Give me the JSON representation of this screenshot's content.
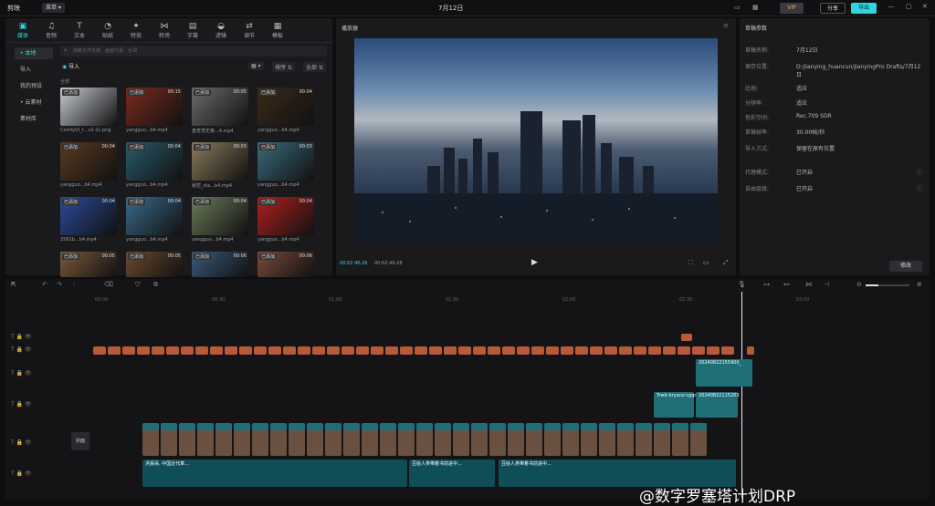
{
  "app": {
    "name": "剪映",
    "menu": "菜单 ▾",
    "title": "7月12日",
    "vip_label": "VIP",
    "share_label": "分享",
    "export_label": "导出"
  },
  "media": {
    "tools": [
      {
        "label": "媒体",
        "icon": "▣"
      },
      {
        "label": "音频",
        "icon": "♫"
      },
      {
        "label": "文本",
        "icon": "T"
      },
      {
        "label": "贴纸",
        "icon": "◔"
      },
      {
        "label": "特效",
        "icon": "✦"
      },
      {
        "label": "转场",
        "icon": "⋈"
      },
      {
        "label": "字幕",
        "icon": "▤"
      },
      {
        "label": "滤镜",
        "icon": "◒"
      },
      {
        "label": "调节",
        "icon": "⇄"
      },
      {
        "label": "模板",
        "icon": "▦"
      }
    ],
    "sidebar": [
      "• 本地",
      "导入",
      "我的预设",
      "• 云素材",
      "素材库"
    ],
    "search_placeholder": "搜索文件名称、画面元素、台词",
    "import_label": "导入",
    "sort_label": "排序 ⇅",
    "filter_label": "全部 ⇅",
    "section_label": "全部",
    "items": [
      {
        "badge": "已添加",
        "duration": "",
        "caption": "ComfyUI_t...v2-2c.png",
        "color": "#c7cbd0"
      },
      {
        "badge": "已添加",
        "duration": "00:15",
        "caption": "yangguo...b4.mp4",
        "color": "#7a2a1c"
      },
      {
        "badge": "已添加",
        "duration": "00:05",
        "caption": "盘查党史第...4.mp4",
        "color": "#6b6b6b"
      },
      {
        "badge": "已添加",
        "duration": "00:04",
        "caption": "yangguo...b4.mp4",
        "color": "#3a2a18"
      },
      {
        "badge": "已添加",
        "duration": "00:04",
        "caption": "yangguo...b4.mp4",
        "color": "#5a3a20"
      },
      {
        "badge": "已添加",
        "duration": "00:04",
        "caption": "yangguo...b4.mp4",
        "color": "#2a5a6a"
      },
      {
        "badge": "已添加",
        "duration": "00:03",
        "caption": "秘密_sta...b4.mp4",
        "color": "#8a7a5a"
      },
      {
        "badge": "已添加",
        "duration": "00:03",
        "caption": "yangguo...b4.mp4",
        "color": "#3a6a7a"
      },
      {
        "badge": "已添加",
        "duration": "00:04",
        "caption": "2561b...b4.mp4",
        "color": "#2a4a9a"
      },
      {
        "badge": "已添加",
        "duration": "00:04",
        "caption": "yangguo...b4.mp4",
        "color": "#3a6a8a"
      },
      {
        "badge": "已添加",
        "duration": "00:04",
        "caption": "yangguo...b4.mp4",
        "color": "#6a7a5a"
      },
      {
        "badge": "已添加",
        "duration": "00:04",
        "caption": "yangguo...b4.mp4",
        "color": "#b02020"
      },
      {
        "badge": "已添加",
        "duration": "00:05",
        "caption": "",
        "color": "#7a5a3a"
      },
      {
        "badge": "已添加",
        "duration": "00:05",
        "caption": "",
        "color": "#6a4a30"
      },
      {
        "badge": "已添加",
        "duration": "00:06",
        "caption": "",
        "color": "#3a5a7a"
      },
      {
        "badge": "已添加",
        "duration": "00:06",
        "caption": "",
        "color": "#7a4a3a"
      }
    ]
  },
  "player": {
    "title": "播放器",
    "time_current": "00:02:46:26",
    "time_total": "00:02:49:28"
  },
  "draft": {
    "title": "草稿参数",
    "props": [
      {
        "label": "草稿名称:",
        "value": "7月12日"
      },
      {
        "label": "保存位置:",
        "value": "D:/jianying_huancun/JianyingPro Drafts/7月12日"
      },
      {
        "label": "比例:",
        "value": "适应"
      },
      {
        "label": "分辨率:",
        "value": "适应"
      },
      {
        "label": "色彩空间:",
        "value": "Rec.709 SDR"
      },
      {
        "label": "草稿帧率:",
        "value": "30.00帧/秒"
      },
      {
        "label": "导入方式:",
        "value": "保留在原有位置"
      },
      {
        "label": "代理模式:",
        "value": "已开启"
      },
      {
        "label": "自由层级:",
        "value": "已开启"
      }
    ],
    "edit_label": "修改"
  },
  "timeline": {
    "ruler": [
      "00:00",
      "00:30",
      "01:00",
      "01:30",
      "02:00",
      "02:30",
      "03:00"
    ],
    "cover_label": "封面",
    "clip_labels": {
      "a": "20240822155900_",
      "b": "20240822115203",
      "c": "Trwb-bryanz-cgqr",
      "audio1": "洪晨哥, 中国近代革...",
      "audio2": "豆给人类带着书前进中...",
      "audio3": "豆给人类带着书前进中..."
    }
  },
  "watermark": "@数字罗塞塔计划DRP",
  "colors": {
    "accent": "#2fd6e0",
    "text_clip": "#b85a3a",
    "video_clip": "#1f6f78"
  }
}
